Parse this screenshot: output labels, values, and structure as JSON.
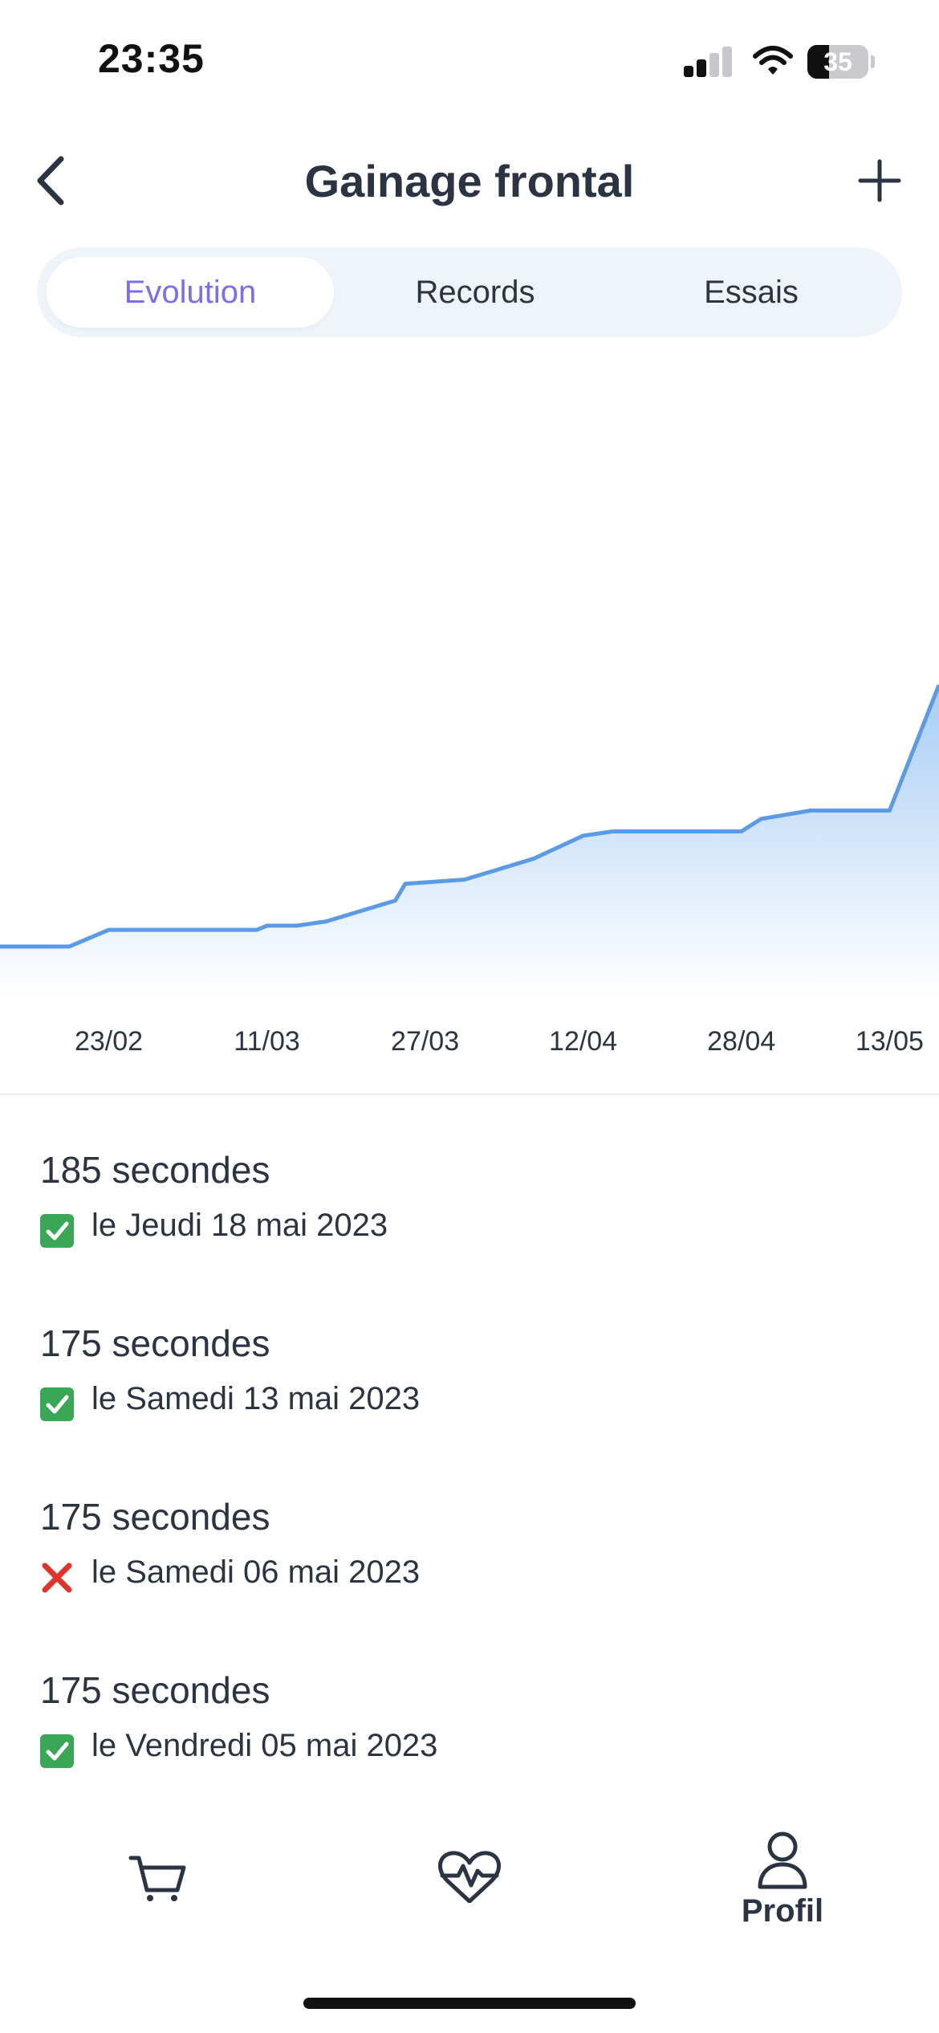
{
  "status_bar": {
    "time": "23:35",
    "battery_level": "35",
    "signal_bars": 2
  },
  "header": {
    "title": "Gainage frontal",
    "back_icon": "chevron-left-icon",
    "add_icon": "plus-icon"
  },
  "tabs": [
    {
      "label": "Evolution",
      "active": true
    },
    {
      "label": "Records",
      "active": false
    },
    {
      "label": "Essais",
      "active": false
    }
  ],
  "colors": {
    "accent": "#7a6df0",
    "line": "#5b9be6",
    "area_top": "#a9cdf4",
    "text": "#2a3442",
    "tab_bg": "#eef4fa"
  },
  "chart_data": {
    "type": "area",
    "x_tick_labels": [
      "23/02",
      "11/03",
      "27/03",
      "12/04",
      "28/04",
      "13/05"
    ],
    "x_range": [
      "2023-02-12",
      "2023-05-18"
    ],
    "x": [
      "2023-02-12",
      "2023-02-19",
      "2023-02-23",
      "2023-03-10",
      "2023-03-11",
      "2023-03-14",
      "2023-03-17",
      "2023-03-24",
      "2023-03-25",
      "2023-03-31",
      "2023-04-07",
      "2023-04-12",
      "2023-04-15",
      "2023-04-28",
      "2023-04-30",
      "2023-05-05",
      "2023-05-13",
      "2023-05-18"
    ],
    "y": [
      60,
      60,
      68,
      68,
      70,
      70,
      72,
      82,
      90,
      92,
      102,
      113,
      115,
      115,
      121,
      125,
      125,
      185
    ],
    "ylabel": "secondes",
    "grid": false,
    "show_y_axis": false
  },
  "history": [
    {
      "value": "185 secondes",
      "success": true,
      "date": "le Jeudi 18 mai 2023",
      "icon": "check-icon"
    },
    {
      "value": "175 secondes",
      "success": true,
      "date": "le Samedi 13 mai 2023",
      "icon": "check-icon"
    },
    {
      "value": "175 secondes",
      "success": false,
      "date": "le Samedi 06 mai 2023",
      "icon": "cross-icon"
    },
    {
      "value": "175 secondes",
      "success": true,
      "date": "le Vendredi 05 mai 2023",
      "icon": "check-icon"
    }
  ],
  "bottom_nav": [
    {
      "name": "cart",
      "icon": "cart-icon",
      "label": ""
    },
    {
      "name": "health",
      "icon": "heart-pulse-icon",
      "label": ""
    },
    {
      "name": "profile",
      "icon": "user-icon",
      "label": "Profil"
    }
  ]
}
